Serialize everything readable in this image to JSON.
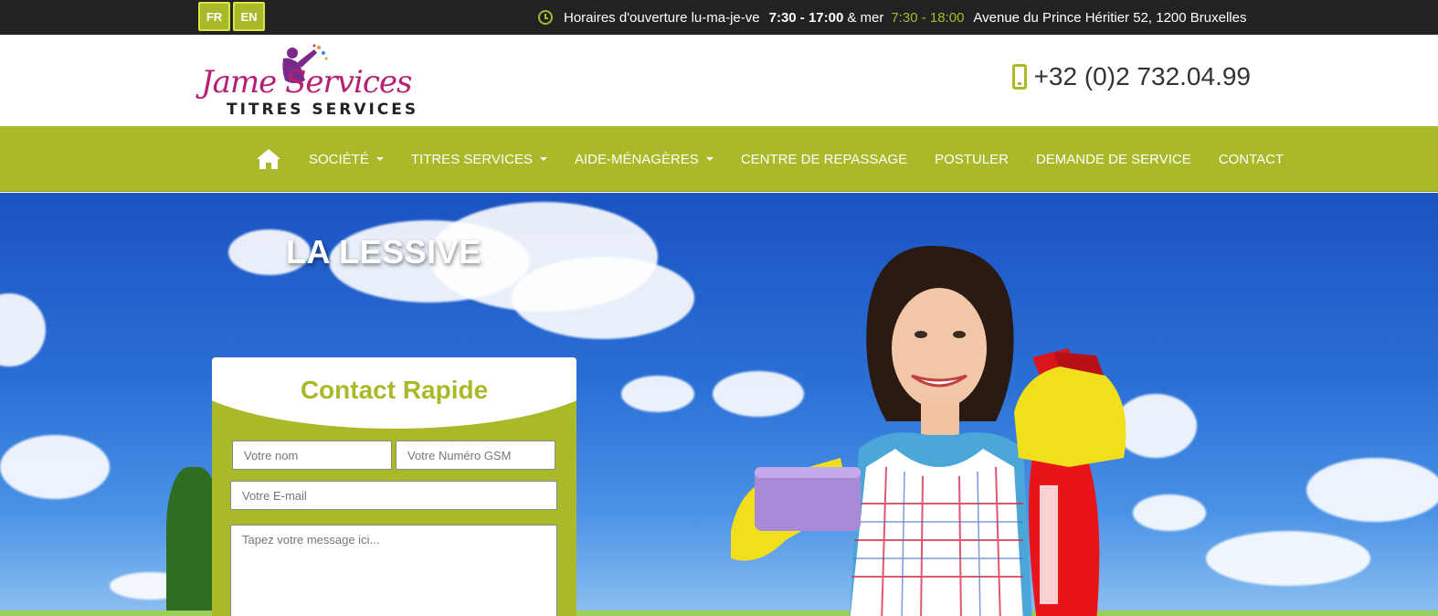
{
  "topbar": {
    "lang_fr": "FR",
    "lang_en": "EN",
    "hours_label": "Horaires d'ouverture lu-ma-je-ve",
    "hours_weekday": "7:30 - 17:00",
    "hours_join": "& mer",
    "hours_wed": "7:30 - 18:00",
    "address": "Avenue du Prince Héritier 52, 1200 Bruxelles"
  },
  "header": {
    "logo_script": "Jame Services",
    "logo_sub": "TITRES SERVICES",
    "phone": "+32 (0)2 732.04.99"
  },
  "nav": {
    "items": [
      {
        "label": "SOCIÉTÉ",
        "dropdown": true
      },
      {
        "label": "TITRES SERVICES",
        "dropdown": true
      },
      {
        "label": "AIDE-MÉNAGÈRES",
        "dropdown": true
      },
      {
        "label": "CENTRE DE REPASSAGE",
        "dropdown": false
      },
      {
        "label": "POSTULER",
        "dropdown": false
      },
      {
        "label": "DEMANDE DE SERVICE",
        "dropdown": false
      },
      {
        "label": "CONTACT",
        "dropdown": false
      }
    ]
  },
  "hero": {
    "title": "LA LESSIVE"
  },
  "contact": {
    "title": "Contact Rapide",
    "name_placeholder": "Votre nom",
    "gsm_placeholder": "Votre Numéro GSM",
    "email_placeholder": "Votre E-mail",
    "message_placeholder": "Tapez votre message ici..."
  },
  "colors": {
    "accent": "#a9b929",
    "topbar": "#222222",
    "brand_pink": "#b61f72"
  }
}
